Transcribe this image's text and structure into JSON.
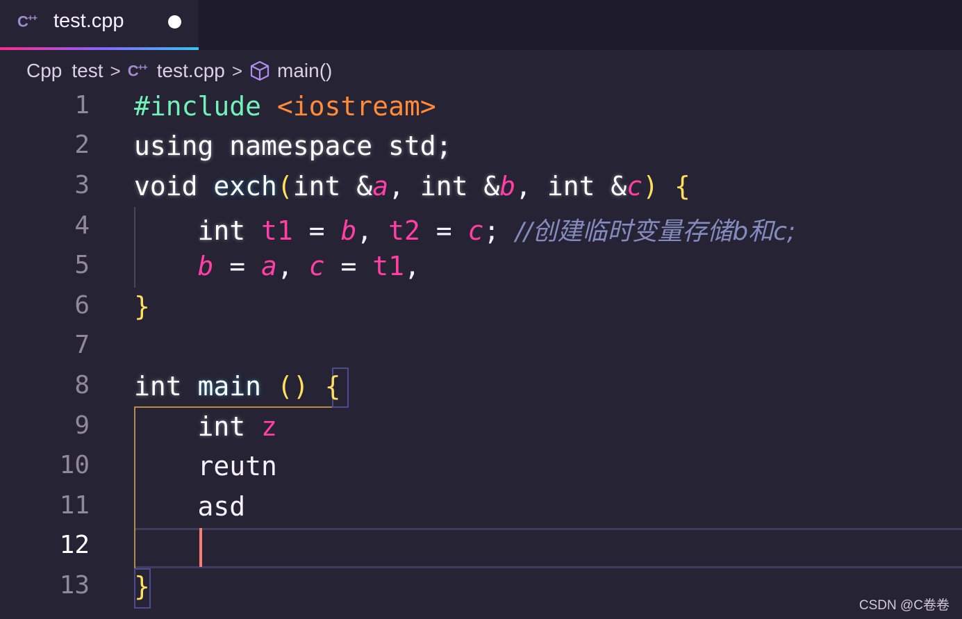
{
  "tab": {
    "title": "test.cpp",
    "icon": "cpp-file-icon",
    "modified": true
  },
  "breadcrumb": {
    "root": "Cpp",
    "folder": "test",
    "file": "test.cpp",
    "symbol": "main()"
  },
  "editor": {
    "active_line": "12",
    "line_numbers": [
      "1",
      "2",
      "3",
      "4",
      "5",
      "6",
      "7",
      "8",
      "9",
      "10",
      "11",
      "12",
      "13"
    ],
    "lines": {
      "l1": {
        "p1": "#include",
        "p2": " ",
        "p3": "<iostream>"
      },
      "l2": {
        "p1": "using namespace std;"
      },
      "l3": {
        "p1": "void ",
        "p2": "exch",
        "p3": "(",
        "p4": "int &",
        "p5": "a",
        "p6": ", ",
        "p7": "int &",
        "p8": "b",
        "p9": ", ",
        "p10": "int &",
        "p11": "c",
        "p12": ")",
        "p13": " ",
        "p14": "{"
      },
      "l4": {
        "p1": "    int ",
        "p2": "t1",
        "p3": " = ",
        "p4": "b",
        "p5": ", ",
        "p6": "t2",
        "p7": " = ",
        "p8": "c",
        "p9": "; ",
        "p10": "//创建临时变量存储b和c;"
      },
      "l5": {
        "p1": "    ",
        "p2": "b",
        "p3": " = ",
        "p4": "a",
        "p5": ", ",
        "p6": "c",
        "p7": " = ",
        "p8": "t1",
        "p9": ","
      },
      "l6": {
        "p1": "}"
      },
      "l7": {
        "p1": ""
      },
      "l8": {
        "p1": "int ",
        "p2": "main",
        "p3": " ",
        "p4": "()",
        "p5": " ",
        "p6": "{"
      },
      "l9": {
        "p1": "    int ",
        "p2": "z"
      },
      "l10": {
        "p1": "    reutn"
      },
      "l11": {
        "p1": "    asd"
      },
      "l12": {
        "p1": ""
      },
      "l13": {
        "p1": "}"
      }
    }
  },
  "watermark": "CSDN @C卷卷",
  "colors": {
    "background": "#262335",
    "keyword": "#fdfdfd",
    "preprocessor": "#72f1b8",
    "string": "#ff8b39",
    "variable": "#ff3fa4",
    "brace": "#fede5d",
    "comment": "#848bbd",
    "cursor": "#f97e72"
  }
}
